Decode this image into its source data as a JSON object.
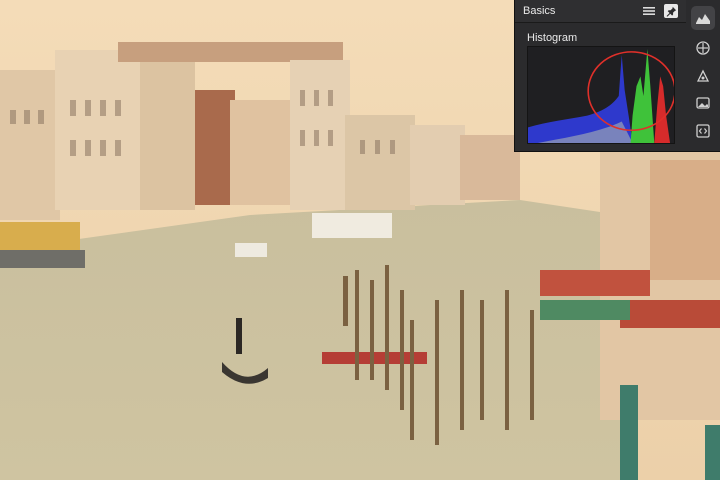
{
  "panel": {
    "title": "Basics",
    "section": "Histogram",
    "menu_icon": "hamburger-menu-icon",
    "pin_icon": "pin-icon"
  },
  "toolbar": {
    "items": [
      {
        "icon": "histogram-icon",
        "active": true
      },
      {
        "icon": "crop-target-icon",
        "active": false
      },
      {
        "icon": "adjustments-icon",
        "active": false
      },
      {
        "icon": "image-icon",
        "active": false
      },
      {
        "icon": "code-brackets-icon",
        "active": false
      }
    ]
  },
  "highlight_color": "#e0302a",
  "histogram_colors": {
    "blue": "#2f3bd6",
    "green": "#3fc23a",
    "red": "#d62b2b",
    "luma": "#9aa3b5"
  }
}
